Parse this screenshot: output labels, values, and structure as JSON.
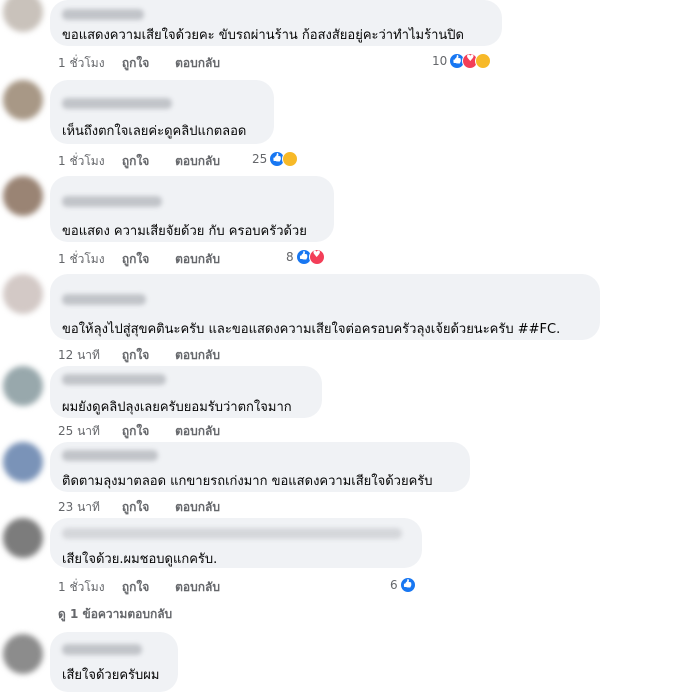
{
  "comments": [
    {
      "text": "ขอแสดงความเสียใจด้วยคะ ขับรถผ่านร้าน ก้อสงสัยอยู่คะว่าทำไมร้านปิด",
      "time": "1 ชั่วโมง",
      "like": "ถูกใจ",
      "reply": "ตอบกลับ",
      "reactions": "10",
      "avatar_color": "#c9c2bb"
    },
    {
      "text": "เห็นถึงตกใจเลยค่ะดูคลิปแกตลอด",
      "time": "1 ชั่วโมง",
      "like": "ถูกใจ",
      "reply": "ตอบกลับ",
      "reactions": "25",
      "avatar_color": "#a89886"
    },
    {
      "text": "ขอแสดง ความเสียจัยด้วย กับ ครอบครัวด้วย",
      "time": "1 ชั่วโมง",
      "like": "ถูกใจ",
      "reply": "ตอบกลับ",
      "reactions": "8",
      "avatar_color": "#9a8474"
    },
    {
      "text": "ขอให้ลุงไปสู่สุขคตินะครับ และขอแสดงความเสียใจต่อครอบครัวลุงเจ้ยด้วยนะครับ ##FC.",
      "time": "12 นาที",
      "like": "ถูกใจ",
      "reply": "ตอบกลับ",
      "reactions": "",
      "avatar_color": "#d3c9c6"
    },
    {
      "text": "ผมยังดูคลิปลุงเลยครับยอมรับว่าตกใจมาก",
      "time": "25 นาที",
      "like": "ถูกใจ",
      "reply": "ตอบกลับ",
      "reactions": "",
      "avatar_color": "#98a8ac"
    },
    {
      "text": "ติดตามลุงมาตลอด แกขายรถเก่งมาก ขอแสดงความเสียใจด้วยครับ",
      "time": "23 นาที",
      "like": "ถูกใจ",
      "reply": "ตอบกลับ",
      "reactions": "",
      "avatar_color": "#7a93b8"
    },
    {
      "text": "เสียใจด้วย.ผมชอบดูแกครับ.",
      "time": "1 ชั่วโมง",
      "like": "ถูกใจ",
      "reply": "ตอบกลับ",
      "reactions": "6",
      "avatar_color": "#7c7c7c"
    },
    {
      "text": "เสียใจด้วยครับผม",
      "time": "",
      "like": "",
      "reply": "",
      "reactions": "",
      "avatar_color": "#8c8c8c"
    }
  ],
  "view_replies": "ดู 1 ข้อความตอบกลับ",
  "colors": {
    "bubble": "#f0f2f5",
    "like_blue": "#1877f2",
    "love_red": "#f33e58",
    "haha_yellow": "#f7b928",
    "meta_gray": "#65676b"
  },
  "icons": {
    "like": "like-icon",
    "love": "love-icon",
    "sad": "sad-icon",
    "care": "care-icon"
  }
}
